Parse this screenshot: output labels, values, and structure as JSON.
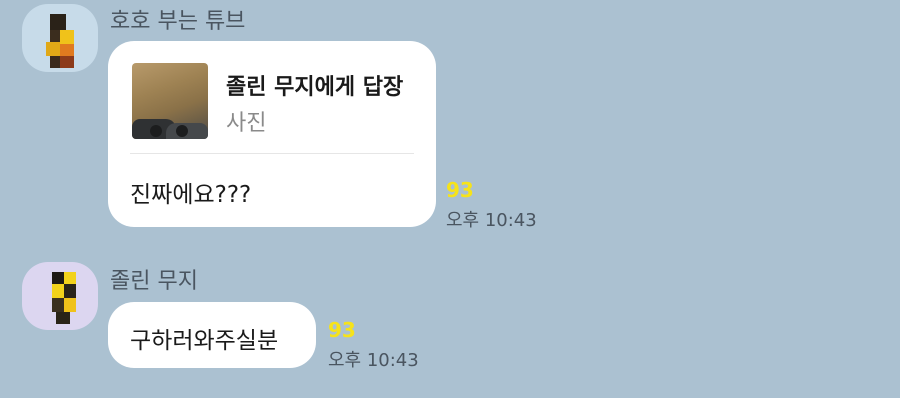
{
  "messages": [
    {
      "sender": "호호 부는 튜브",
      "reply": {
        "title": "졸린 무지에게 답장",
        "subtitle": "사진"
      },
      "text": "진짜에요???",
      "unread": "93",
      "time": "오후 10:43"
    },
    {
      "sender": "졸린 무지",
      "text": "구하러와주실분",
      "unread": "93",
      "time": "오후 10:43"
    }
  ],
  "colors": {
    "background": "#abc1d1",
    "bubble": "#ffffff",
    "unread": "#f6e31a"
  }
}
